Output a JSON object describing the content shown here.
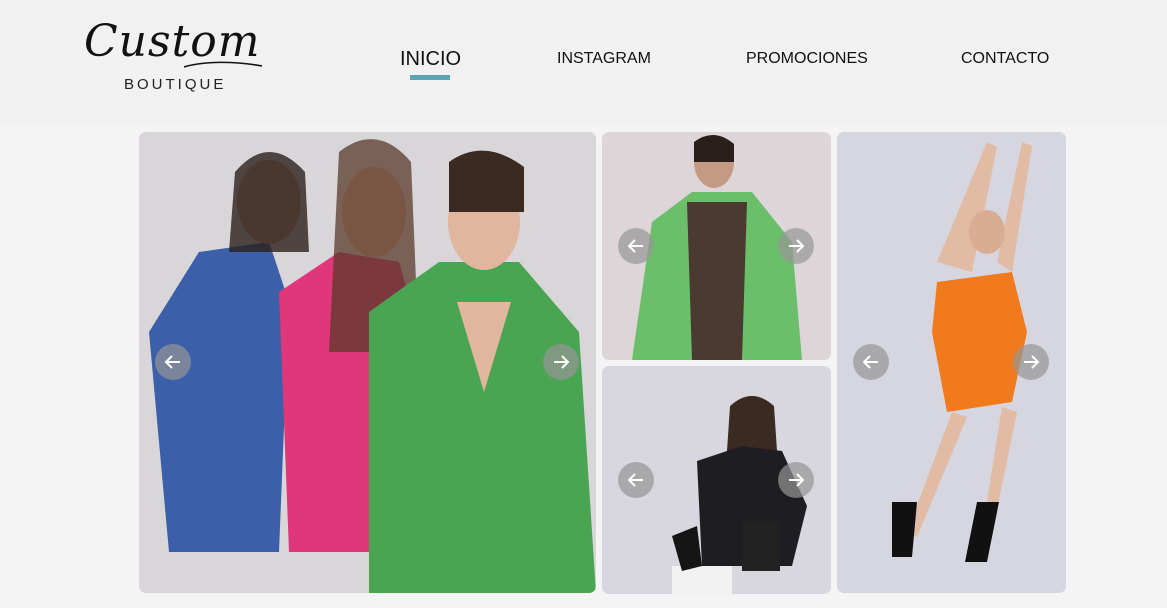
{
  "brand": {
    "script": "Custom",
    "subtitle": "BOUTIQUE"
  },
  "nav": {
    "items": [
      {
        "label": "INICIO",
        "active": true
      },
      {
        "label": "INSTAGRAM",
        "active": false
      },
      {
        "label": "PROMOCIONES",
        "active": false
      },
      {
        "label": "CONTACTO",
        "active": false
      }
    ]
  },
  "colors": {
    "accent": "#5aa5b5",
    "header_bg": "#f1f1f1",
    "page_bg": "#f4f4f4"
  },
  "gallery": {
    "cards": [
      {
        "name": "three-women-blazers",
        "arrows": [
          "arrow-left-icon",
          "arrow-right-icon"
        ]
      },
      {
        "name": "woman-green-blazer",
        "arrows": [
          "arrow-left-icon",
          "arrow-right-icon"
        ]
      },
      {
        "name": "woman-black-jacket",
        "arrows": [
          "arrow-left-icon",
          "arrow-right-icon"
        ]
      },
      {
        "name": "woman-orange-dress",
        "arrows": [
          "arrow-left-icon",
          "arrow-right-icon"
        ]
      }
    ]
  }
}
